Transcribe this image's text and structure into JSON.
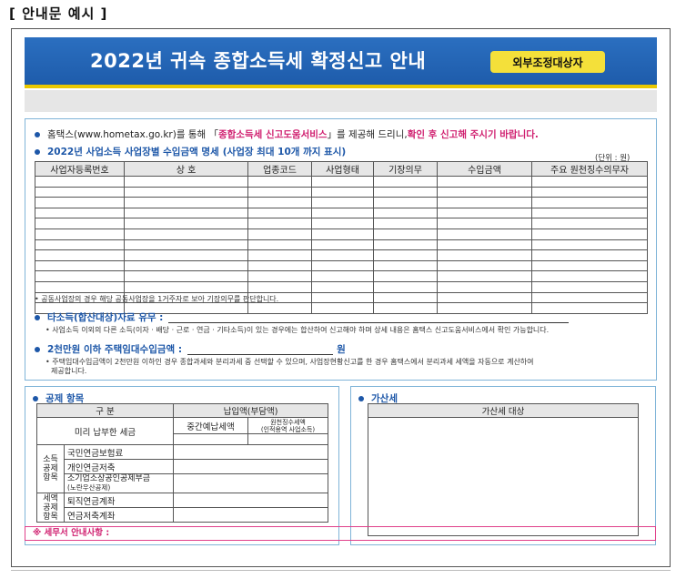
{
  "caption": "[ 안내문 예시 ]",
  "header": {
    "title": "2022년 귀속 종합소득세 확정신고 안내",
    "badge": "외부조정대상자"
  },
  "notice": {
    "prefix": "홈택스(www.hometax.go.kr)를 통해 「",
    "service": "종합소득세 신고도움서비스",
    "middle": "」를 제공해 드리니, ",
    "emphasis": "확인 후 신고해 주시기 바랍니다."
  },
  "business_section": {
    "title": "2022년 사업소득 사업장별 수입금액 명세",
    "title_suffix": "(사업장 최대 10개 까지 표시)",
    "unit": "(단위 : 원)",
    "columns": [
      "사업자등록번호",
      "상        호",
      "업종코드",
      "사업형태",
      "기장의무",
      "수입금액",
      "주요 원천징수의무자"
    ],
    "row_count": 13,
    "footnote": "• 공동사업장의 경우 해당 공동사업장을 1거주자로 보아 기장의무를 판단합니다."
  },
  "other_income": {
    "label": "타소득(합산대상)자료 유무 :",
    "note": "• 사업소득 이외의 다른 소득(이자 · 배당 · 근로 · 연금 · 기타소득)이 있는 경우에는 합산하여 신고해야 하며 상세 내용은 홈택스 신고도움서비스에서 확인 가능합니다."
  },
  "rental_income": {
    "label": "2천만원 이하 주택임대수입금액 :",
    "unit": "원",
    "note_line1": "• 주택임대수입금액이 2천만원 이하인 경우 종합과세와 분리과세 중 선택할 수 있으며, 사업장현황신고를 한 경우 홈택스에서 분리과세 세액을 자동으로 계산하여",
    "note_line2": "제공합니다."
  },
  "deduction": {
    "title": "공제 항목",
    "col_category": "구        분",
    "col_paid": "납입액(부담액)",
    "col_prepaid": "중간예납세액",
    "col_withheld": "원천징수세액",
    "col_withheld_sub": "(인적용역 사업소득)",
    "prepaid_row": "미리 납부한 세금",
    "income_group": "소득\n공제\n항목",
    "income_items": [
      "국민연금보험료",
      "개인연금저축",
      "소기업소상공인공제부금"
    ],
    "income_item_sub": "(노란우산공제)",
    "tax_group": "세액\n공제\n항목",
    "tax_items": [
      "퇴직연금계좌",
      "연금저축계좌"
    ]
  },
  "penalty": {
    "title": "가산세",
    "column": "가산세 대상"
  },
  "tax_agent": {
    "label": "※ 세무서 안내사항 :"
  },
  "colors": {
    "header_blue": "#1e5cab",
    "badge_yellow": "#f4e03a",
    "bullet_blue": "#1d57a8",
    "emphasis_red": "#c4122f",
    "agent_pink": "#d02070"
  }
}
